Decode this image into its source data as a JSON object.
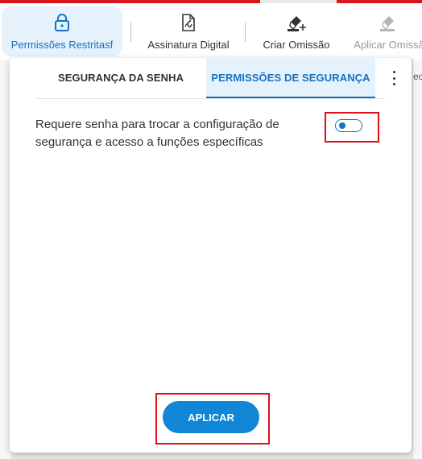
{
  "ribbon": {
    "items": [
      {
        "label": "Permissões Restritasf",
        "icon": "lock-icon",
        "state": "active"
      },
      {
        "label": "Assinatura Digital",
        "icon": "digital-signature-icon",
        "state": "normal"
      },
      {
        "label": "Criar Omissão",
        "icon": "create-redaction-icon",
        "state": "normal"
      },
      {
        "label": "Aplicar Omissã",
        "icon": "apply-redaction-icon",
        "state": "disabled"
      }
    ]
  },
  "background": {
    "right_fragment": "ecu"
  },
  "panel": {
    "tabs": [
      {
        "label": "SEGURANÇA DA SENHA",
        "active": false
      },
      {
        "label": "PERMISSÕES DE SEGURANÇA",
        "active": true
      }
    ],
    "menu_icon": "more-vertical-icon",
    "setting": {
      "description": "Requere senha para trocar a configuração de segurança e acesso a funções específicas",
      "toggle_on": false
    },
    "apply_label": "APLICAR"
  },
  "colors": {
    "accent": "#1572c4",
    "button": "#0f86d6",
    "highlight": "#e0101a",
    "top_strip": "#d9161c",
    "active_tab_bg": "#e5f1fb"
  }
}
